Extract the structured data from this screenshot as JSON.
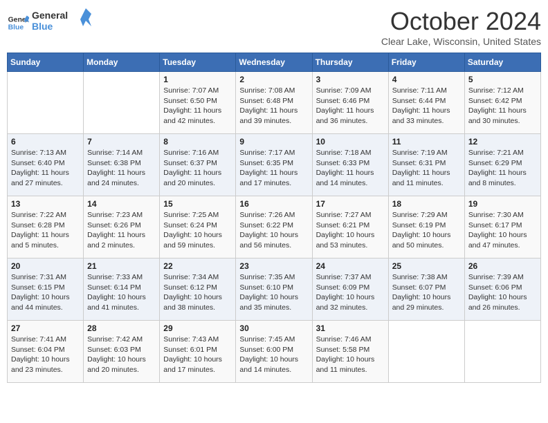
{
  "header": {
    "logo_line1": "General",
    "logo_line2": "Blue",
    "month_title": "October 2024",
    "location": "Clear Lake, Wisconsin, United States"
  },
  "weekdays": [
    "Sunday",
    "Monday",
    "Tuesday",
    "Wednesday",
    "Thursday",
    "Friday",
    "Saturday"
  ],
  "weeks": [
    [
      {
        "day": "",
        "info": ""
      },
      {
        "day": "",
        "info": ""
      },
      {
        "day": "1",
        "info": "Sunrise: 7:07 AM\nSunset: 6:50 PM\nDaylight: 11 hours and 42 minutes."
      },
      {
        "day": "2",
        "info": "Sunrise: 7:08 AM\nSunset: 6:48 PM\nDaylight: 11 hours and 39 minutes."
      },
      {
        "day": "3",
        "info": "Sunrise: 7:09 AM\nSunset: 6:46 PM\nDaylight: 11 hours and 36 minutes."
      },
      {
        "day": "4",
        "info": "Sunrise: 7:11 AM\nSunset: 6:44 PM\nDaylight: 11 hours and 33 minutes."
      },
      {
        "day": "5",
        "info": "Sunrise: 7:12 AM\nSunset: 6:42 PM\nDaylight: 11 hours and 30 minutes."
      }
    ],
    [
      {
        "day": "6",
        "info": "Sunrise: 7:13 AM\nSunset: 6:40 PM\nDaylight: 11 hours and 27 minutes."
      },
      {
        "day": "7",
        "info": "Sunrise: 7:14 AM\nSunset: 6:38 PM\nDaylight: 11 hours and 24 minutes."
      },
      {
        "day": "8",
        "info": "Sunrise: 7:16 AM\nSunset: 6:37 PM\nDaylight: 11 hours and 20 minutes."
      },
      {
        "day": "9",
        "info": "Sunrise: 7:17 AM\nSunset: 6:35 PM\nDaylight: 11 hours and 17 minutes."
      },
      {
        "day": "10",
        "info": "Sunrise: 7:18 AM\nSunset: 6:33 PM\nDaylight: 11 hours and 14 minutes."
      },
      {
        "day": "11",
        "info": "Sunrise: 7:19 AM\nSunset: 6:31 PM\nDaylight: 11 hours and 11 minutes."
      },
      {
        "day": "12",
        "info": "Sunrise: 7:21 AM\nSunset: 6:29 PM\nDaylight: 11 hours and 8 minutes."
      }
    ],
    [
      {
        "day": "13",
        "info": "Sunrise: 7:22 AM\nSunset: 6:28 PM\nDaylight: 11 hours and 5 minutes."
      },
      {
        "day": "14",
        "info": "Sunrise: 7:23 AM\nSunset: 6:26 PM\nDaylight: 11 hours and 2 minutes."
      },
      {
        "day": "15",
        "info": "Sunrise: 7:25 AM\nSunset: 6:24 PM\nDaylight: 10 hours and 59 minutes."
      },
      {
        "day": "16",
        "info": "Sunrise: 7:26 AM\nSunset: 6:22 PM\nDaylight: 10 hours and 56 minutes."
      },
      {
        "day": "17",
        "info": "Sunrise: 7:27 AM\nSunset: 6:21 PM\nDaylight: 10 hours and 53 minutes."
      },
      {
        "day": "18",
        "info": "Sunrise: 7:29 AM\nSunset: 6:19 PM\nDaylight: 10 hours and 50 minutes."
      },
      {
        "day": "19",
        "info": "Sunrise: 7:30 AM\nSunset: 6:17 PM\nDaylight: 10 hours and 47 minutes."
      }
    ],
    [
      {
        "day": "20",
        "info": "Sunrise: 7:31 AM\nSunset: 6:15 PM\nDaylight: 10 hours and 44 minutes."
      },
      {
        "day": "21",
        "info": "Sunrise: 7:33 AM\nSunset: 6:14 PM\nDaylight: 10 hours and 41 minutes."
      },
      {
        "day": "22",
        "info": "Sunrise: 7:34 AM\nSunset: 6:12 PM\nDaylight: 10 hours and 38 minutes."
      },
      {
        "day": "23",
        "info": "Sunrise: 7:35 AM\nSunset: 6:10 PM\nDaylight: 10 hours and 35 minutes."
      },
      {
        "day": "24",
        "info": "Sunrise: 7:37 AM\nSunset: 6:09 PM\nDaylight: 10 hours and 32 minutes."
      },
      {
        "day": "25",
        "info": "Sunrise: 7:38 AM\nSunset: 6:07 PM\nDaylight: 10 hours and 29 minutes."
      },
      {
        "day": "26",
        "info": "Sunrise: 7:39 AM\nSunset: 6:06 PM\nDaylight: 10 hours and 26 minutes."
      }
    ],
    [
      {
        "day": "27",
        "info": "Sunrise: 7:41 AM\nSunset: 6:04 PM\nDaylight: 10 hours and 23 minutes."
      },
      {
        "day": "28",
        "info": "Sunrise: 7:42 AM\nSunset: 6:03 PM\nDaylight: 10 hours and 20 minutes."
      },
      {
        "day": "29",
        "info": "Sunrise: 7:43 AM\nSunset: 6:01 PM\nDaylight: 10 hours and 17 minutes."
      },
      {
        "day": "30",
        "info": "Sunrise: 7:45 AM\nSunset: 6:00 PM\nDaylight: 10 hours and 14 minutes."
      },
      {
        "day": "31",
        "info": "Sunrise: 7:46 AM\nSunset: 5:58 PM\nDaylight: 10 hours and 11 minutes."
      },
      {
        "day": "",
        "info": ""
      },
      {
        "day": "",
        "info": ""
      }
    ]
  ]
}
